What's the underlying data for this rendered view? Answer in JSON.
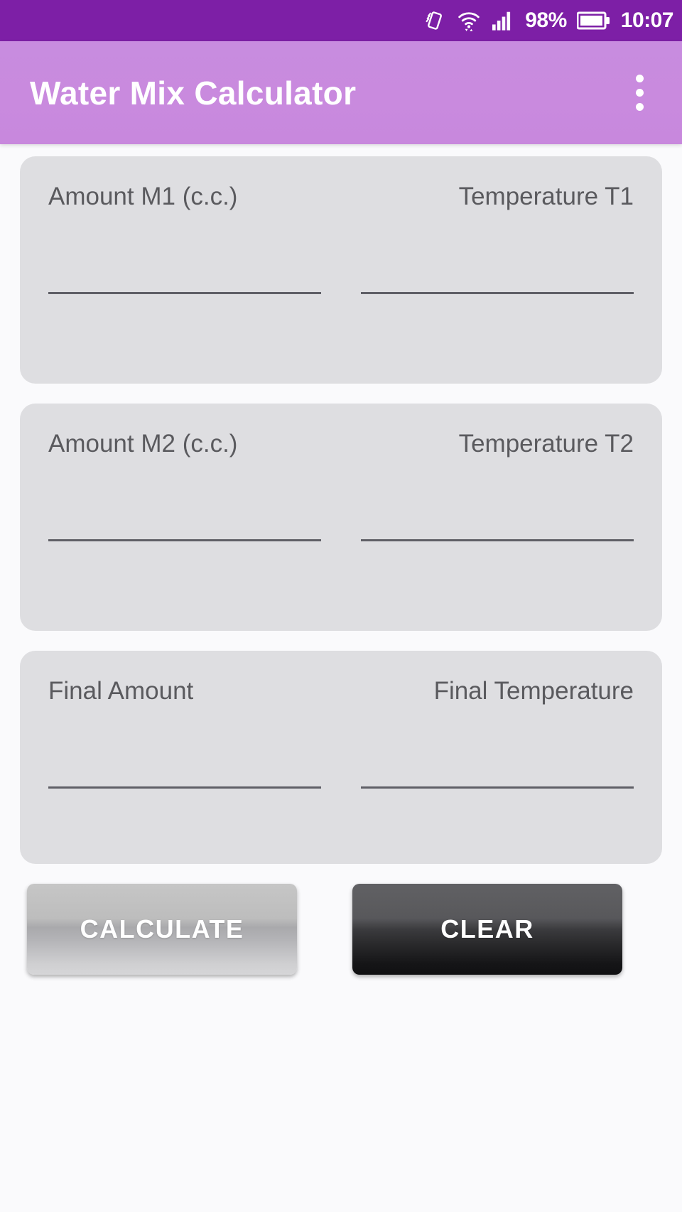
{
  "status_bar": {
    "background_color": "#7d1fa6",
    "icons": [
      {
        "name": "screen-rotation-icon",
        "glyph": "rotate"
      },
      {
        "name": "wifi-icon",
        "glyph": "wifi"
      },
      {
        "name": "signal-bars-icon",
        "glyph": "signal"
      }
    ],
    "battery_percent": "98%",
    "battery_icon": "battery-icon",
    "time": "10:07"
  },
  "app_bar": {
    "title": "Water Mix Calculator",
    "background_color": "#c98ade",
    "title_color": "#ffffff",
    "overflow_menu_label": "More options"
  },
  "cards": [
    {
      "id": "card-input-1",
      "left": {
        "label": "Amount M1 (c.c.)",
        "value": "",
        "placeholder": ""
      },
      "right": {
        "label": "Temperature T1",
        "value": "",
        "placeholder": ""
      }
    },
    {
      "id": "card-input-2",
      "left": {
        "label": "Amount M2 (c.c.)",
        "value": "",
        "placeholder": ""
      },
      "right": {
        "label": "Temperature T2",
        "value": "",
        "placeholder": ""
      }
    },
    {
      "id": "card-result",
      "left": {
        "label": "Final Amount",
        "value": "",
        "placeholder": ""
      },
      "right": {
        "label": "Final Temperature",
        "value": "",
        "placeholder": ""
      }
    }
  ],
  "buttons": {
    "calculate_label": "CALCULATE",
    "clear_label": "CLEAR"
  },
  "page": {
    "background_color": "#fafafc",
    "card_color": "#dedee1",
    "label_color": "#5a5a5e"
  }
}
